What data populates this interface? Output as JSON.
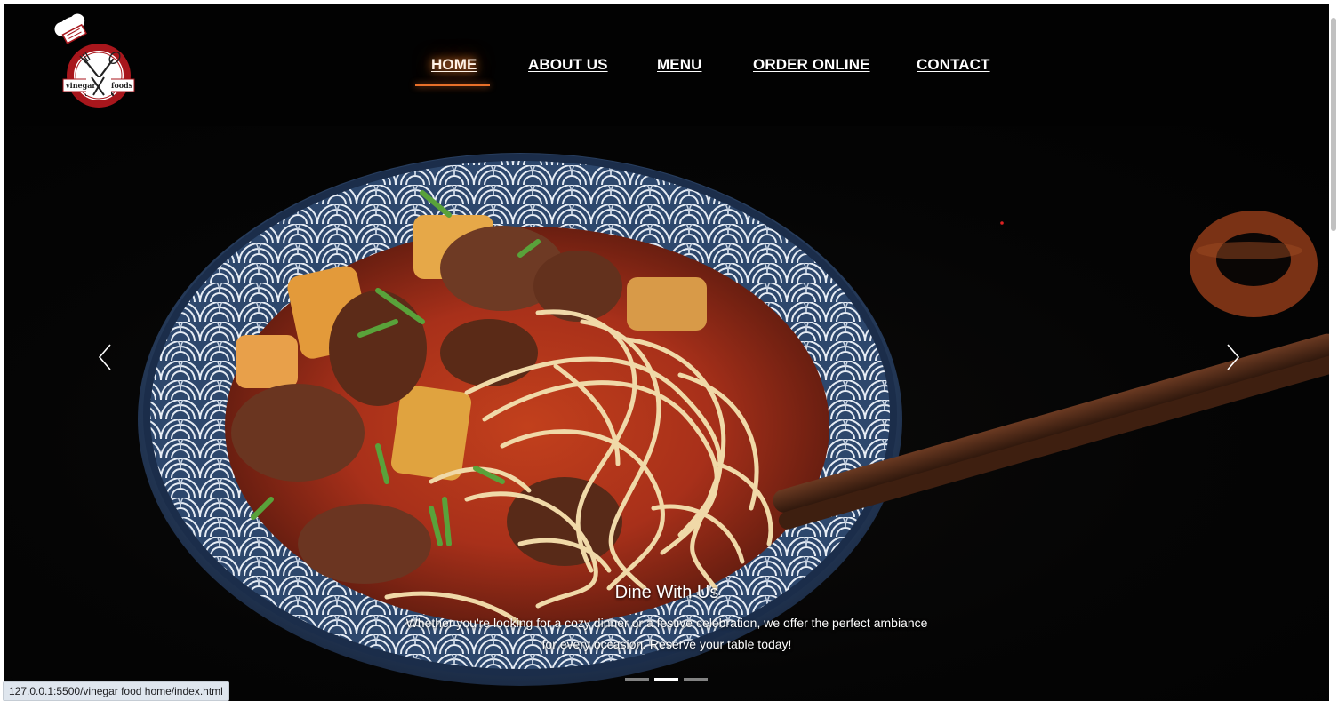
{
  "brand": {
    "logo_text_left": "vinegar",
    "logo_text_right": "foods"
  },
  "nav": {
    "items": [
      {
        "label": "HOME",
        "active": true
      },
      {
        "label": "ABOUT US",
        "active": false
      },
      {
        "label": "MENU",
        "active": false
      },
      {
        "label": "ORDER ONLINE",
        "active": false
      },
      {
        "label": "CONTACT",
        "active": false
      }
    ]
  },
  "carousel": {
    "caption_title": "Dine With Us",
    "caption_text": "Whether you're looking for a cozy dinner or a festive celebration, we offer the perfect ambiance for every occasion. Reserve your table today!",
    "slide_count": 3,
    "active_slide": 2,
    "prev_icon": "chevron-left-icon",
    "next_icon": "chevron-right-icon"
  },
  "status_bar": {
    "url": "127.0.0.1:5500/vinegar food home/index.html"
  },
  "colors": {
    "accent": "#e8702a",
    "background": "#000000",
    "logo_red": "#a8161c",
    "text": "#ffffff"
  }
}
